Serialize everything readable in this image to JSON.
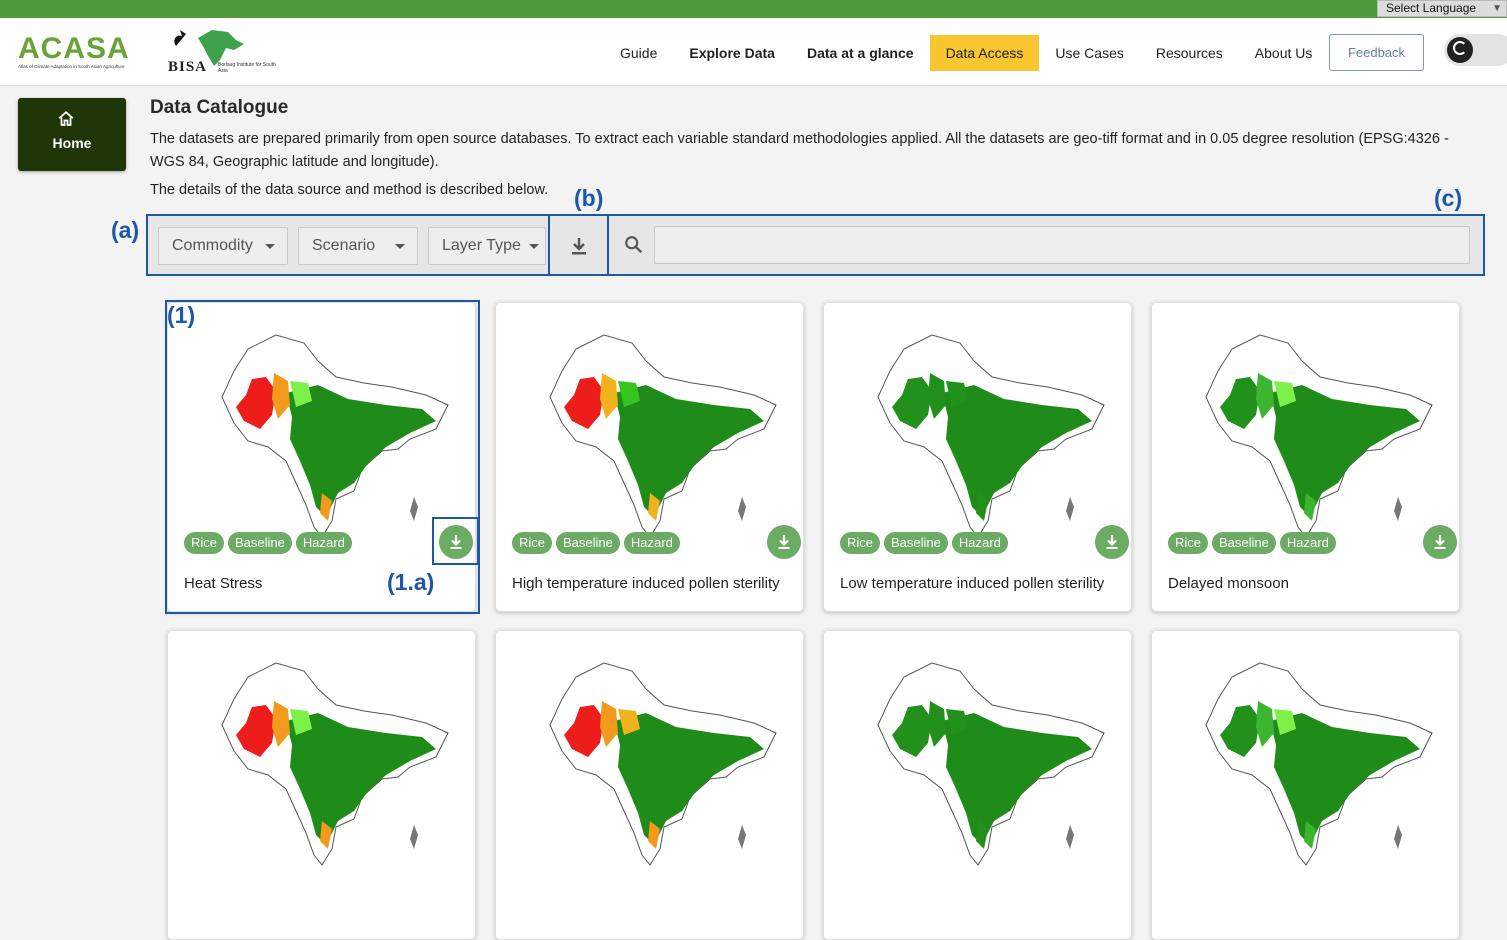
{
  "language_selector": {
    "label": "Select Language"
  },
  "header": {
    "brand": {
      "acasa_word": "ACASA",
      "acasa_subtitle": "Atlas of Climate Adaptation in South Asian Agriculture",
      "bisa_word": "BISA",
      "bisa_subtitle": "Borlaug Institute for South Asia"
    },
    "nav": [
      {
        "label": "Guide"
      },
      {
        "label": "Explore Data"
      },
      {
        "label": "Data at a glance"
      },
      {
        "label": "Data Access"
      },
      {
        "label": "Use Cases"
      },
      {
        "label": "Resources"
      },
      {
        "label": "About Us"
      }
    ],
    "feedback_label": "Feedback"
  },
  "sidebar": {
    "home_label": "Home"
  },
  "main": {
    "title": "Data Catalogue",
    "description": "The datasets are prepared primarily from open source databases. To extract each variable standard methodologies applied. All the datasets are geo-tiff format and in 0.05 degree resolution (EPSG:4326 - WGS 84, Geographic latitude and longitude).",
    "details": "The details of the data source and method is described below.",
    "filters": {
      "commodity": "Commodity",
      "scenario": "Scenario",
      "layer_type": "Layer Type"
    },
    "search": {
      "value": ""
    }
  },
  "annotations": {
    "a": "(a)",
    "b": "(b)",
    "c": "(c)",
    "card": "(1)",
    "card_download": "(1.a)"
  },
  "cards": [
    {
      "title": "Heat Stress",
      "tags": [
        "Rice",
        "Baseline",
        "Hazard"
      ],
      "map_variant": "heat"
    },
    {
      "title": "High temperature induced pollen sterility",
      "tags": [
        "Rice",
        "Baseline",
        "Hazard"
      ],
      "map_variant": "pollen_high"
    },
    {
      "title": "Low temperature induced pollen sterility",
      "tags": [
        "Rice",
        "Baseline",
        "Hazard"
      ],
      "map_variant": "pollen_low"
    },
    {
      "title": "Delayed monsoon",
      "tags": [
        "Rice",
        "Baseline",
        "Hazard"
      ],
      "map_variant": "monsoon"
    },
    {
      "title": "",
      "tags": [],
      "map_variant": "heat"
    },
    {
      "title": "",
      "tags": [],
      "map_variant": "heat2"
    },
    {
      "title": "",
      "tags": [],
      "map_variant": "pollen_low"
    },
    {
      "title": "",
      "tags": [],
      "map_variant": "monsoon"
    }
  ],
  "colors": {
    "accent_green": "#4f9a3c",
    "chip_green": "#6bab63",
    "active_nav": "#f7c631",
    "home_bg": "#1e3608",
    "annotation_blue": "#1c57a8"
  }
}
